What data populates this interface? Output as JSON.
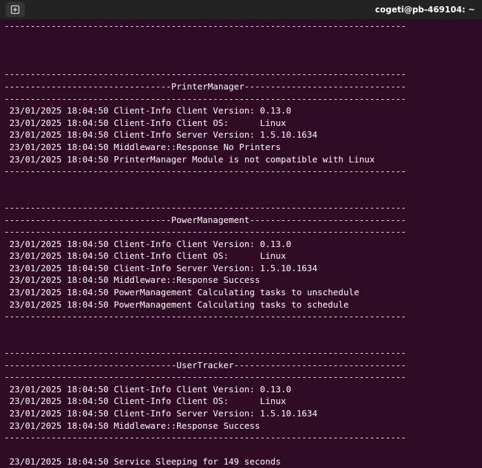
{
  "window": {
    "title": "cogeti@pb-469104: ~"
  },
  "terminal": {
    "lines": [
      "-----------------------------------------------------------------------------",
      "",
      "",
      "",
      "-----------------------------------------------------------------------------",
      "--------------------------------PrinterManager-------------------------------",
      "-----------------------------------------------------------------------------",
      " 23/01/2025 18:04:50 Client-Info Client Version: 0.13.0",
      " 23/01/2025 18:04:50 Client-Info Client OS:      Linux",
      " 23/01/2025 18:04:50 Client-Info Server Version: 1.5.10.1634",
      " 23/01/2025 18:04:50 Middleware::Response No Printers",
      " 23/01/2025 18:04:50 PrinterManager Module is not compatible with Linux",
      "-----------------------------------------------------------------------------",
      "",
      "",
      "-----------------------------------------------------------------------------",
      "--------------------------------PowerManagement------------------------------",
      "-----------------------------------------------------------------------------",
      " 23/01/2025 18:04:50 Client-Info Client Version: 0.13.0",
      " 23/01/2025 18:04:50 Client-Info Client OS:      Linux",
      " 23/01/2025 18:04:50 Client-Info Server Version: 1.5.10.1634",
      " 23/01/2025 18:04:50 Middleware::Response Success",
      " 23/01/2025 18:04:50 PowerManagement Calculating tasks to unschedule",
      " 23/01/2025 18:04:50 PowerManagement Calculating tasks to schedule",
      "-----------------------------------------------------------------------------",
      "",
      "",
      "-----------------------------------------------------------------------------",
      "---------------------------------UserTracker---------------------------------",
      "-----------------------------------------------------------------------------",
      " 23/01/2025 18:04:50 Client-Info Client Version: 0.13.0",
      " 23/01/2025 18:04:50 Client-Info Client OS:      Linux",
      " 23/01/2025 18:04:50 Client-Info Server Version: 1.5.10.1634",
      " 23/01/2025 18:04:50 Middleware::Response Success",
      "-----------------------------------------------------------------------------",
      "",
      " 23/01/2025 18:04:50 Service Sleeping for 149 seconds"
    ]
  }
}
